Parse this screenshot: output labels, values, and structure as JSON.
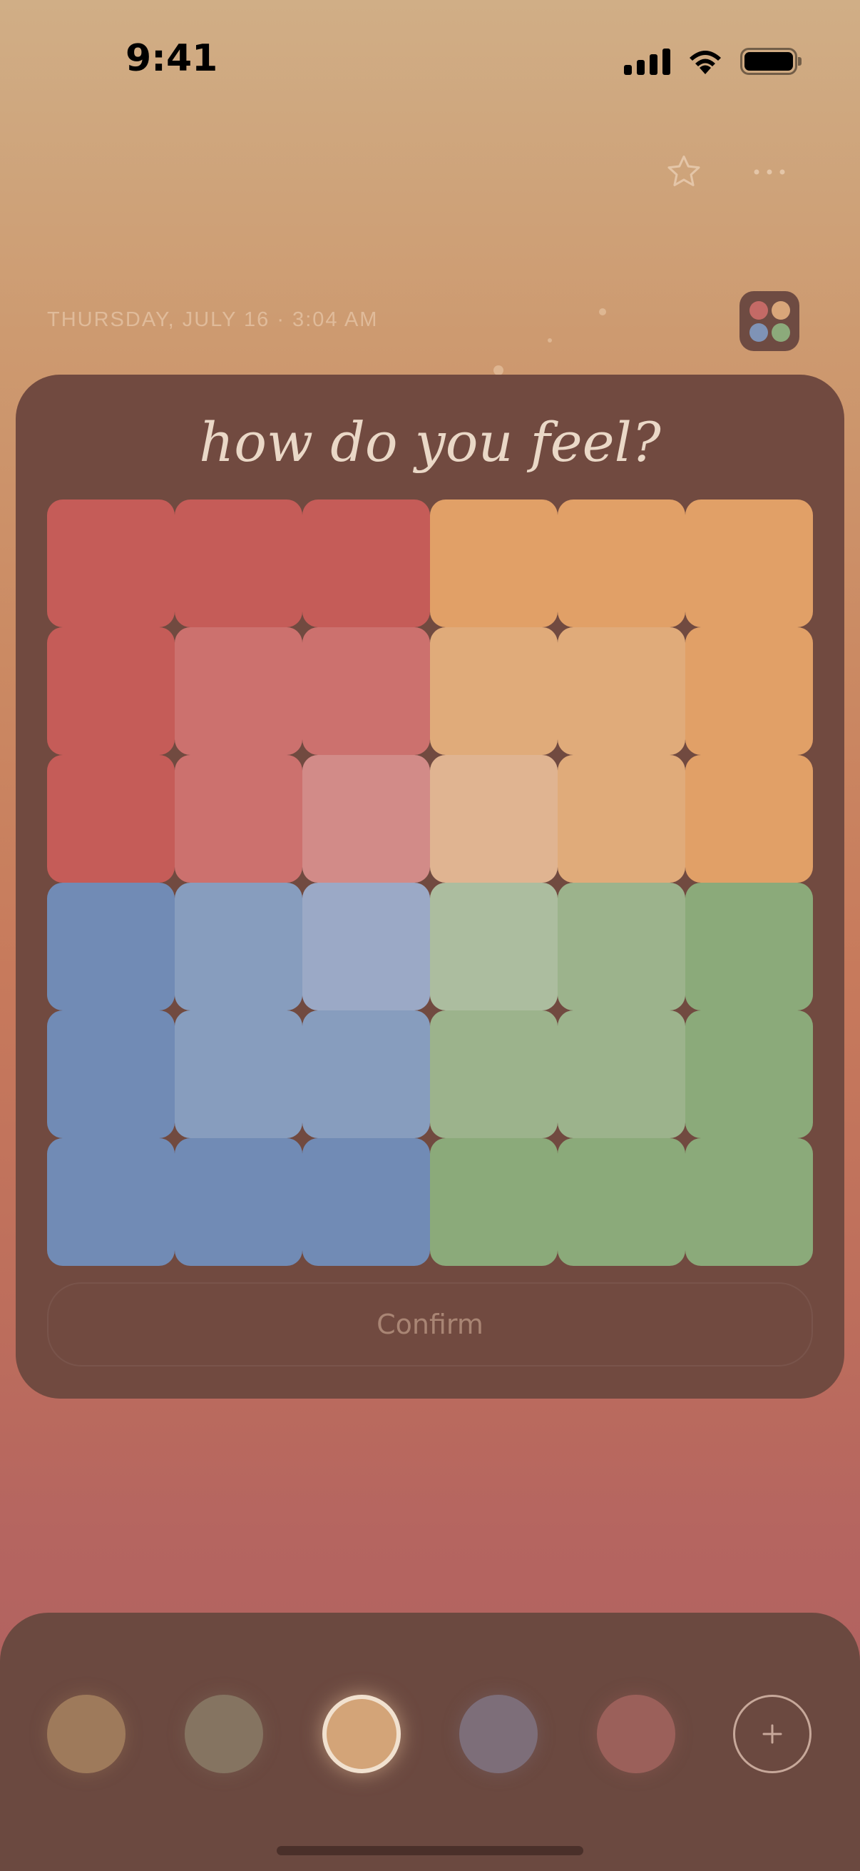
{
  "status": {
    "time": "9:41",
    "icons": [
      "cellular-signal-icon",
      "wifi-icon",
      "battery-icon"
    ]
  },
  "top_actions": {
    "favorite_icon": "star-outline-icon",
    "more_icon": "more-horizontal-icon"
  },
  "entry": {
    "date_time": "THURSDAY, JULY 16 · 3:04 AM",
    "badge_colors": [
      "#c46a66",
      "#d9a67a",
      "#7f93b6",
      "#8caa7b"
    ]
  },
  "mood_card": {
    "title": "how do you feel?",
    "confirm_label": "Confirm",
    "grid_rows": [
      [
        "#c55c58",
        "#c55c58",
        "#c55c58",
        "#e1a067",
        "#e1a067",
        "#e1a067"
      ],
      [
        "#c55c58",
        "#cc716e",
        "#cc716e",
        "#e0ab7a",
        "#e0ab7a",
        "#e1a067"
      ],
      [
        "#c55c58",
        "#cc716e",
        "#d28b88",
        "#e0b491",
        "#e0ab7a",
        "#e1a067"
      ],
      [
        "#718bb5",
        "#879dbe",
        "#9ba9c6",
        "#acbd9f",
        "#9cb38c",
        "#8baa7a"
      ],
      [
        "#718bb5",
        "#879dbe",
        "#879dbe",
        "#9cb38c",
        "#9cb38c",
        "#8baa7a"
      ],
      [
        "#718bb5",
        "#718bb5",
        "#718bb5",
        "#8baa7a",
        "#8baa7a",
        "#8baa7a"
      ]
    ]
  },
  "theme_picker": {
    "swatches": [
      {
        "color": "#9e7a5b",
        "selected": false
      },
      {
        "color": "#857461",
        "selected": false
      },
      {
        "color": "#d3a478",
        "selected": true
      },
      {
        "color": "#7d6e79",
        "selected": false
      },
      {
        "color": "#9b605a",
        "selected": false
      }
    ],
    "add_icon": "plus-icon"
  }
}
